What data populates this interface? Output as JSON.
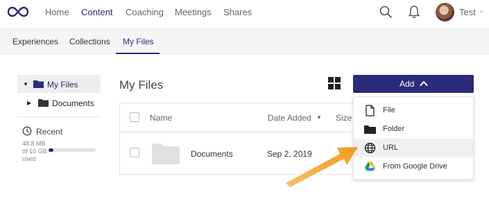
{
  "nav": {
    "links": [
      "Home",
      "Content",
      "Coaching",
      "Meetings",
      "Shares"
    ],
    "active": "Content",
    "user_name": "Test",
    "user_caret": "⌄"
  },
  "subnav": {
    "tabs": [
      "Experiences",
      "Collections",
      "My Files"
    ],
    "active": "My Files"
  },
  "sidebar": {
    "tree": [
      {
        "label": "My Files",
        "caret": "▼",
        "selected": true
      },
      {
        "label": "Documents",
        "caret": "▶",
        "selected": false
      }
    ],
    "recent_label": "Recent",
    "storage_line1": "48.8 MB",
    "storage_line2": "of 10 GB",
    "storage_line3": "used",
    "storage_fraction": 0.0049
  },
  "main": {
    "title": "My Files",
    "add_label": "Add",
    "columns": [
      "Name",
      "Date Added",
      "Size"
    ],
    "sort_indicator": "▼",
    "rows": [
      {
        "name": "Documents",
        "date": "Sep 2, 2019"
      }
    ]
  },
  "menu": {
    "items": [
      {
        "label": "File",
        "icon": "file-icon"
      },
      {
        "label": "Folder",
        "icon": "folder-icon"
      },
      {
        "label": "URL",
        "icon": "globe-icon"
      },
      {
        "label": "From Google Drive",
        "icon": "google-drive-icon"
      }
    ],
    "highlighted_index": 2
  },
  "colors": {
    "brand": "#2c2a7a",
    "annotation_arrow": "#f2a93b"
  }
}
